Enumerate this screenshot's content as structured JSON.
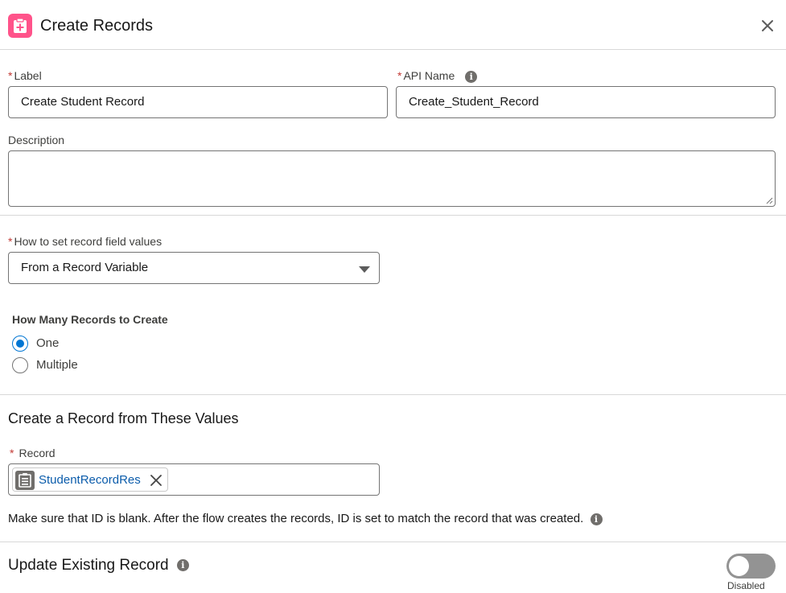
{
  "header": {
    "title": "Create Records",
    "icon": "create-records-icon",
    "accent": "#ff538a"
  },
  "label_field": {
    "label": "Label",
    "required_mark": "*",
    "value": "Create Student Record"
  },
  "api_name_field": {
    "label": "API Name",
    "required_mark": "*",
    "value": "Create_Student_Record"
  },
  "description_field": {
    "label": "Description",
    "value": ""
  },
  "set_values_field": {
    "label": "How to set record field values",
    "required_mark": "*",
    "selected": "From a Record Variable"
  },
  "how_many": {
    "title": "How Many Records to Create",
    "options": [
      {
        "label": "One",
        "checked": true
      },
      {
        "label": "Multiple",
        "checked": false
      }
    ]
  },
  "values_section": {
    "title": "Create a Record from These Values"
  },
  "record_field": {
    "label": "Record",
    "required_mark": "*",
    "pill_value": "StudentRecordRes",
    "help_text": "Make sure that ID is blank. After the flow creates the records, ID is set to match the record that was created."
  },
  "update_existing": {
    "title": "Update Existing Record",
    "toggle_state": "Disabled"
  },
  "colors": {
    "brand_blue": "#0176d3",
    "required_red": "#c23934",
    "link_blue": "#0b5cab"
  }
}
